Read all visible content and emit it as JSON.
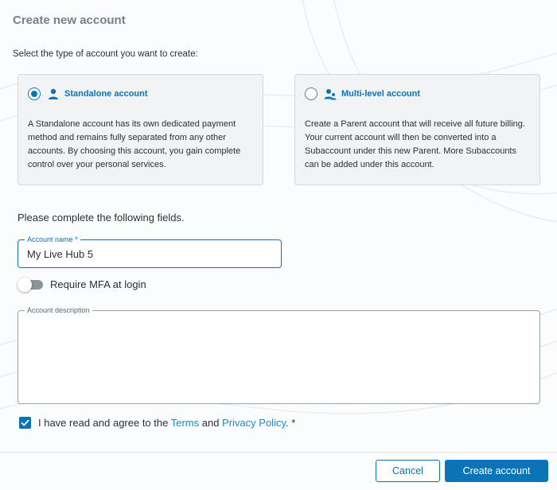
{
  "dialog": {
    "title": "Create new account",
    "instructions": "Select the type of account you want to create:"
  },
  "account_types": [
    {
      "title": "Standalone account",
      "selected": true,
      "icon": "person-icon",
      "description": "A Standalone account has its own dedicated payment method and remains fully separated from any other accounts. By choosing this account, you gain complete control over your personal services."
    },
    {
      "title": "Multi-level account",
      "selected": false,
      "icon": "people-icon",
      "description": "Create a Parent account that will receive all future billing. Your current account will then be converted into a Subaccount under this new Parent. More Subaccounts can be added under this account."
    }
  ],
  "form": {
    "intro": "Please complete the following fields.",
    "account_name": {
      "label": "Account name",
      "required_mark": "*",
      "value": "My Live Hub 5"
    },
    "mfa_toggle": {
      "label": "Require MFA at login",
      "enabled": false
    },
    "account_description": {
      "label": "Account description",
      "value": ""
    },
    "agreement": {
      "checked": true,
      "text_prefix": "I have read and agree to the ",
      "terms_link": "Terms",
      "conjunction": " and ",
      "privacy_link": "Privacy Policy",
      "suffix": ". *"
    }
  },
  "footer": {
    "cancel_label": "Cancel",
    "create_label": "Create account"
  },
  "colors": {
    "accent": "#0a74b6",
    "link": "#1a8ad4",
    "card_bg": "#f1f3f5",
    "title_gray": "#76808c"
  }
}
